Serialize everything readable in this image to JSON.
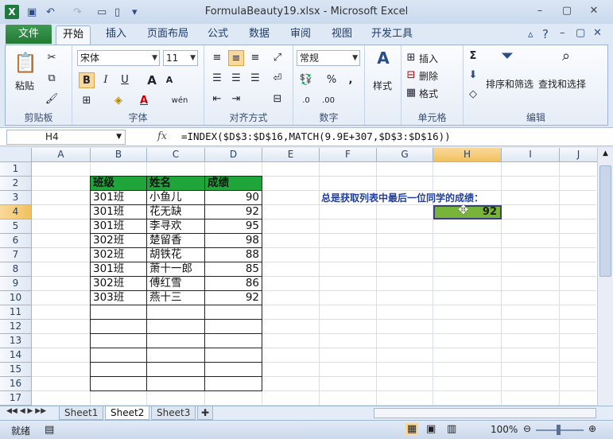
{
  "app": {
    "title": "FormulaBeauty19.xlsx - Microsoft Excel",
    "logo_letter": "X"
  },
  "ribbon": {
    "tabs": [
      "文件",
      "开始",
      "插入",
      "页面布局",
      "公式",
      "数据",
      "审阅",
      "视图",
      "开发工具"
    ],
    "active_tab": "开始",
    "clipboard": {
      "paste": "粘贴",
      "label": "剪贴板"
    },
    "font": {
      "name": "宋体",
      "size": "11",
      "label": "字体",
      "bold": "B",
      "italic": "I",
      "underline": "U",
      "color_a": "A",
      "wen": "wén"
    },
    "alignment": {
      "label": "对齐方式"
    },
    "number": {
      "format": "常规",
      "percent": "%",
      "comma": ",",
      "inc": ".0",
      "dec": ".00",
      "label": "数字"
    },
    "styles": {
      "label": "样式"
    },
    "cells": {
      "insert": "插入",
      "delete": "删除",
      "format": "格式",
      "label": "单元格"
    },
    "editing": {
      "sigma": "Σ",
      "sort": "排序和筛选",
      "find": "查找和选择",
      "label": "编辑"
    }
  },
  "formula_bar": {
    "name_box": "H4",
    "fx": "fx",
    "formula": "=INDEX($D$3:$D$16,MATCH(9.9E+307,$D$3:$D$16))"
  },
  "grid": {
    "columns": [
      "A",
      "B",
      "C",
      "D",
      "E",
      "F",
      "G",
      "H",
      "I",
      "J"
    ],
    "rows": [
      "1",
      "2",
      "3",
      "4",
      "5",
      "6",
      "7",
      "8",
      "9",
      "10",
      "11",
      "12",
      "13",
      "14",
      "15",
      "16",
      "17"
    ],
    "selected_column": "H",
    "selected_row": "4"
  },
  "table": {
    "headers": [
      "班级",
      "姓名",
      "成绩"
    ],
    "rows": [
      [
        "301班",
        "小鱼儿",
        "90"
      ],
      [
        "301班",
        "花无缺",
        "92"
      ],
      [
        "301班",
        "李寻欢",
        "95"
      ],
      [
        "302班",
        "楚留香",
        "98"
      ],
      [
        "302班",
        "胡铁花",
        "88"
      ],
      [
        "301班",
        "萧十一郎",
        "85"
      ],
      [
        "302班",
        "傅红雪",
        "86"
      ],
      [
        "303班",
        "燕十三",
        "92"
      ]
    ]
  },
  "note": "总是获取列表中最后一位同学的成绩：",
  "result_value": "92",
  "sheets": [
    "Sheet1",
    "Sheet2",
    "Sheet3"
  ],
  "active_sheet": "Sheet2",
  "status": {
    "ready": "就绪",
    "zoom": "100%"
  },
  "colors": {
    "header_green": "#1fa53a",
    "result_green": "#78b43a",
    "note_blue": "#1f3fa0"
  }
}
